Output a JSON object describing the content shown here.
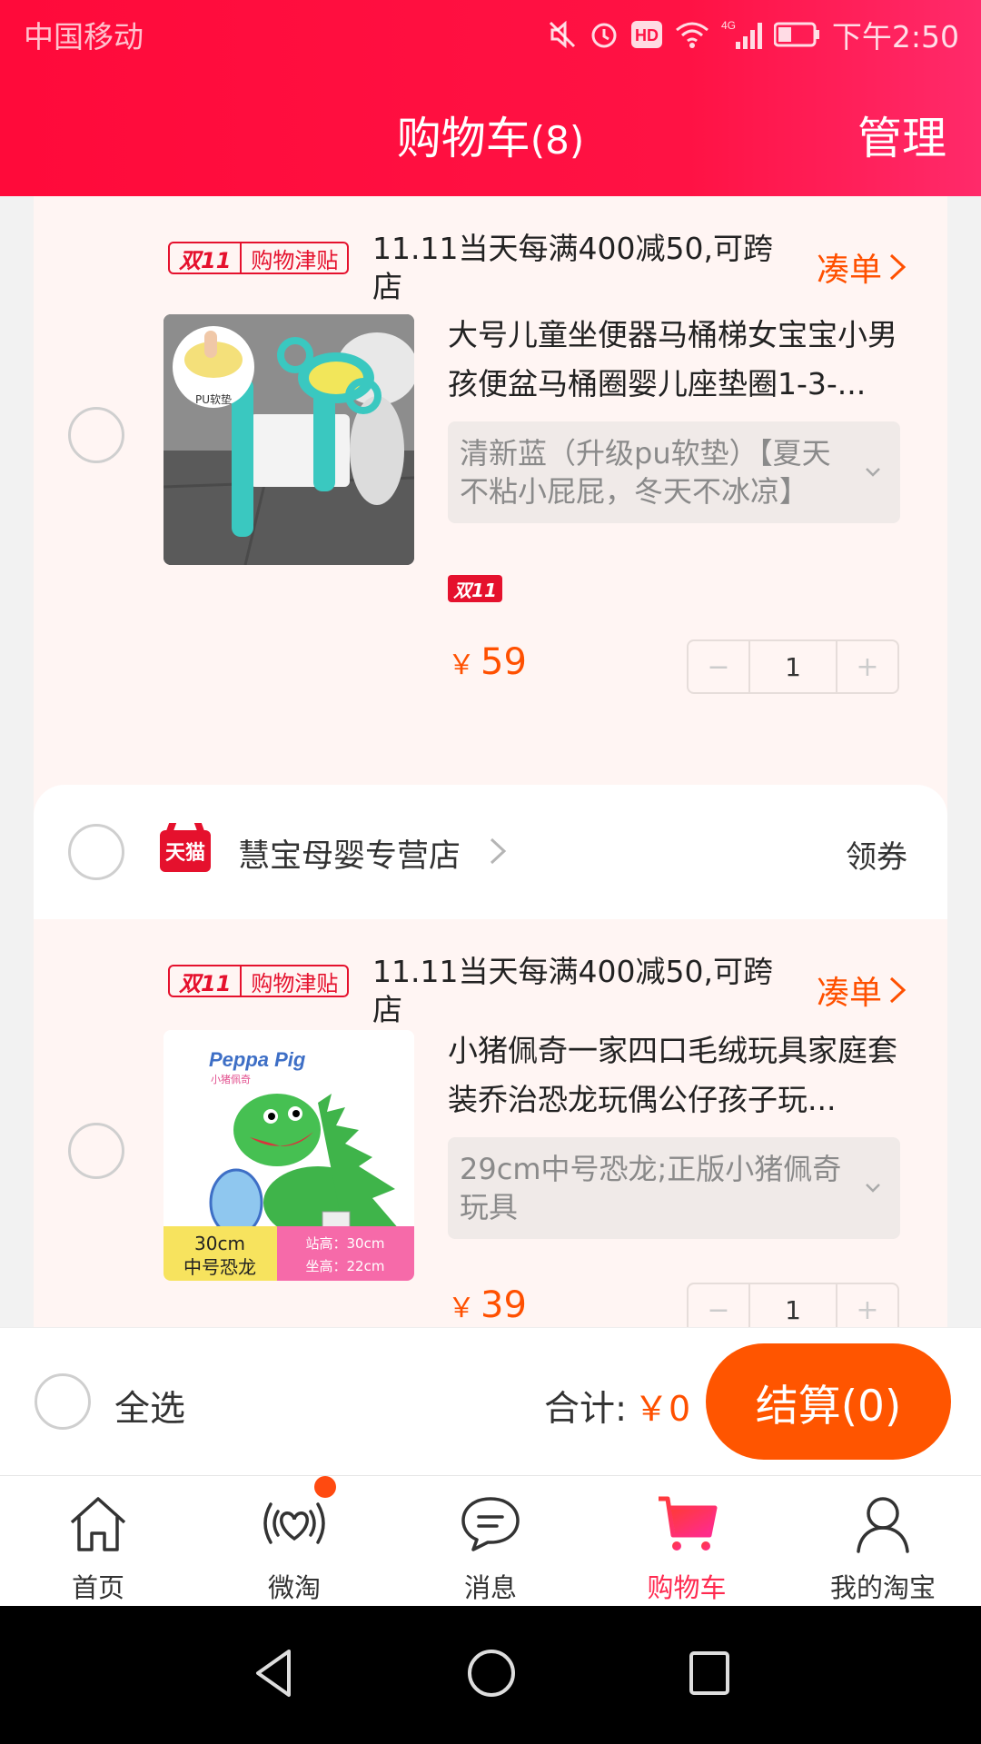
{
  "status_bar": {
    "carrier": "中国移动",
    "time": "下午2:50",
    "icons": [
      "mute-icon",
      "alarm-icon",
      "hd-icon",
      "wifi-icon",
      "signal-4g-icon",
      "battery-icon"
    ],
    "hd_label": "HD",
    "net_label": "4G"
  },
  "header": {
    "title": "购物车",
    "count": "(8)",
    "manage": "管理"
  },
  "promo": {
    "badge_main": "双11",
    "badge_sub": "购物津贴",
    "text": "11.11当天每满400减50,可跨店",
    "link": "凑单"
  },
  "items": [
    {
      "title": "大号儿童坐便器马桶梯女宝宝小男孩便盆马桶圈婴儿座垫圈1-3-...",
      "sku": "清新蓝（升级pu软垫）【夏天不粘小屁屁，冬天不冰凉】",
      "tag": "双11",
      "currency": "￥",
      "price": "59",
      "qty": "1",
      "thumb_label": "PU软垫"
    },
    {
      "title": "小猪佩奇一家四口毛绒玩具家庭套装乔治恐龙玩偶公仔孩子玩...",
      "sku": "29cm中号恐龙;正版小猪佩奇玩具",
      "currency": "￥",
      "price": "39",
      "qty": "1",
      "thumb_brand": "Peppa Pig",
      "thumb_brand_cn": "小猪佩奇",
      "thumb_size": "30cm",
      "thumb_size_label": "中号恐龙",
      "thumb_stand": "站高：30cm",
      "thumb_sit": "坐高：22cm"
    }
  ],
  "store": {
    "badge": "天猫",
    "name": "慧宝母婴专营店",
    "coupon": "领券"
  },
  "checkout": {
    "select_all": "全选",
    "total_label": "合计:",
    "total_value": "￥0",
    "pay_button": "结算(0)"
  },
  "tabs": [
    {
      "label": "首页",
      "icon": "home-icon"
    },
    {
      "label": "微淘",
      "icon": "weitao-icon"
    },
    {
      "label": "消息",
      "icon": "message-icon"
    },
    {
      "label": "购物车",
      "icon": "cart-icon",
      "active": true
    },
    {
      "label": "我的淘宝",
      "icon": "profile-icon"
    }
  ],
  "colors": {
    "header": "#ff0a3a",
    "accent": "#ff5000",
    "tmall": "#e5112d"
  }
}
